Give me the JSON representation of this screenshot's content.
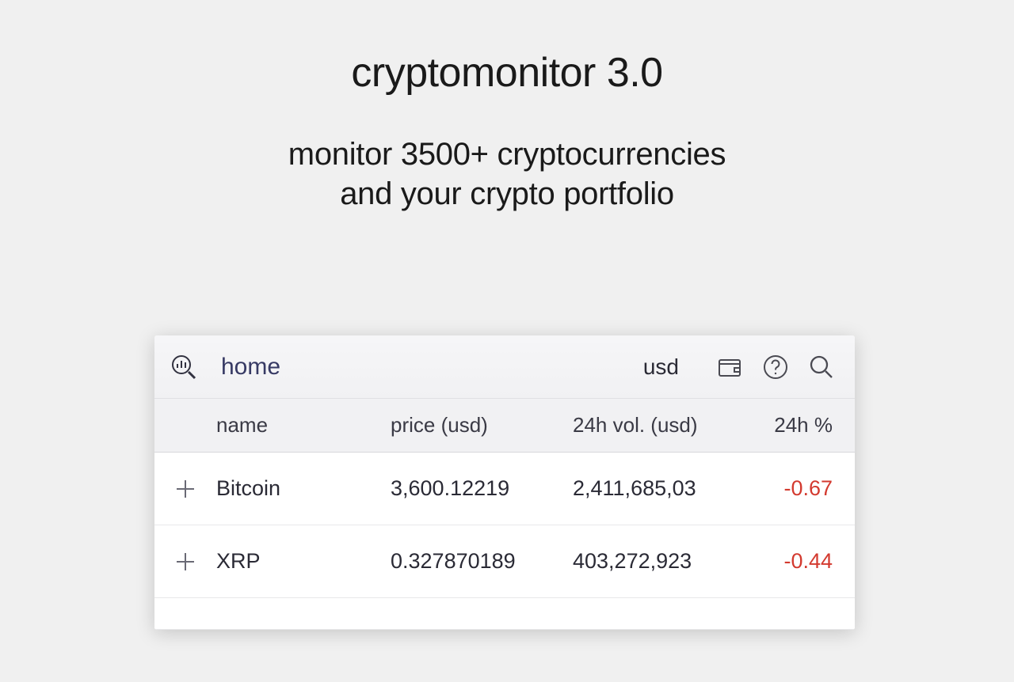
{
  "hero": {
    "title": "cryptomonitor 3.0",
    "subtitle_line1": "monitor 3500+ cryptocurrencies",
    "subtitle_line2": "and your crypto portfolio"
  },
  "header": {
    "home_label": "home",
    "currency": "usd"
  },
  "columns": {
    "name": "name",
    "price": "price (usd)",
    "volume": "24h vol. (usd)",
    "change": "24h %"
  },
  "rows": [
    {
      "name": "Bitcoin",
      "price": "3,600.12219",
      "volume": "2,411,685,03",
      "change": "-0.67",
      "change_class": "change-negative"
    },
    {
      "name": "XRP",
      "price": "0.327870189",
      "volume": "403,272,923",
      "change": "-0.44",
      "change_class": "change-negative"
    }
  ]
}
